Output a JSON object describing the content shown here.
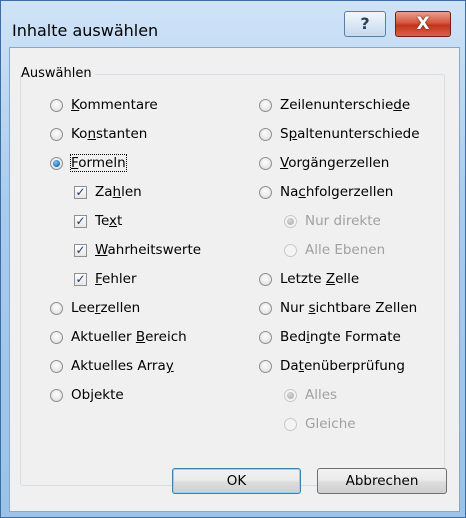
{
  "window": {
    "title": "Inhalte auswählen",
    "help_glyph": "?",
    "close_glyph": "X"
  },
  "group": {
    "label": "Auswählen"
  },
  "left_options": [
    {
      "pre": "",
      "u": "K",
      "post": "ommentare",
      "type": "radio",
      "checked": false
    },
    {
      "pre": "Ko",
      "u": "n",
      "post": "stanten",
      "type": "radio",
      "checked": false
    },
    {
      "pre": "",
      "u": "F",
      "post": "ormeln",
      "type": "radio",
      "checked": true
    },
    {
      "pre": "Za",
      "u": "h",
      "post": "len",
      "type": "check",
      "checked": true
    },
    {
      "pre": "Te",
      "u": "x",
      "post": "t",
      "type": "check",
      "checked": true
    },
    {
      "pre": "",
      "u": "W",
      "post": "ahrheitswerte",
      "type": "check",
      "checked": true
    },
    {
      "pre": "",
      "u": "F",
      "post": "ehler",
      "type": "check",
      "checked": true
    },
    {
      "pre": "Lee",
      "u": "r",
      "post": "zellen",
      "type": "radio",
      "checked": false
    },
    {
      "pre": "Aktueller ",
      "u": "B",
      "post": "ereich",
      "type": "radio",
      "checked": false
    },
    {
      "pre": "Aktuelles Arra",
      "u": "y",
      "post": "",
      "type": "radio",
      "checked": false
    },
    {
      "pre": "Ob",
      "u": "j",
      "post": "ekte",
      "type": "radio",
      "checked": false
    }
  ],
  "right_options": [
    {
      "pre": "Zeilenunterschie",
      "u": "d",
      "post": "e",
      "type": "radio",
      "checked": false,
      "disabled": false
    },
    {
      "pre": "S",
      "u": "p",
      "post": "altenunterschiede",
      "type": "radio",
      "checked": false,
      "disabled": false
    },
    {
      "pre": "",
      "u": "V",
      "post": "orgängerzellen",
      "type": "radio",
      "checked": false,
      "disabled": false
    },
    {
      "pre": "Na",
      "u": "c",
      "post": "hfolgerzellen",
      "type": "radio",
      "checked": false,
      "disabled": false
    },
    {
      "pre": "Nur direkte",
      "u": "",
      "post": "",
      "type": "radio",
      "checked": true,
      "disabled": true
    },
    {
      "pre": "Alle Ebenen",
      "u": "",
      "post": "",
      "type": "radio",
      "checked": false,
      "disabled": true
    },
    {
      "pre": "Letzte ",
      "u": "Z",
      "post": "elle",
      "type": "radio",
      "checked": false,
      "disabled": false
    },
    {
      "pre": "Nur ",
      "u": "s",
      "post": "ichtbare Zellen",
      "type": "radio",
      "checked": false,
      "disabled": false
    },
    {
      "pre": "Bed",
      "u": "i",
      "post": "ngte Formate",
      "type": "radio",
      "checked": false,
      "disabled": false
    },
    {
      "pre": "Da",
      "u": "t",
      "post": "enüberprüfung",
      "type": "radio",
      "checked": false,
      "disabled": false
    },
    {
      "pre": "Alles",
      "u": "",
      "post": "",
      "type": "radio",
      "checked": true,
      "disabled": true
    },
    {
      "pre": "Gleiche",
      "u": "",
      "post": "",
      "type": "radio",
      "checked": false,
      "disabled": true
    }
  ],
  "buttons": {
    "ok": "OK",
    "cancel": "Abbrechen"
  }
}
